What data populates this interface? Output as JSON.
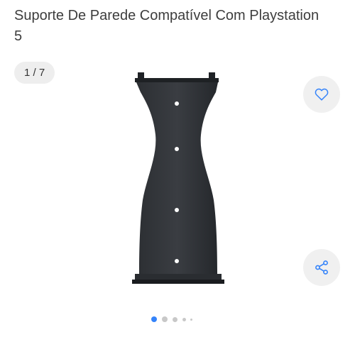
{
  "product": {
    "title": "Suporte De Parede Compatível Com Playstation 5"
  },
  "gallery": {
    "counter": "1 / 7",
    "current_index": 1,
    "total_images": 7,
    "image_alt": "Suporte De Parede Compatível Com Playstation 5",
    "dots_visible": 5,
    "active_dot_color": "#3483fa",
    "inactive_dot_color": "#c8c8c8"
  },
  "actions": {
    "favorite_icon": "heart-icon",
    "share_icon": "share-icon",
    "accent_color": "#3483fa"
  }
}
